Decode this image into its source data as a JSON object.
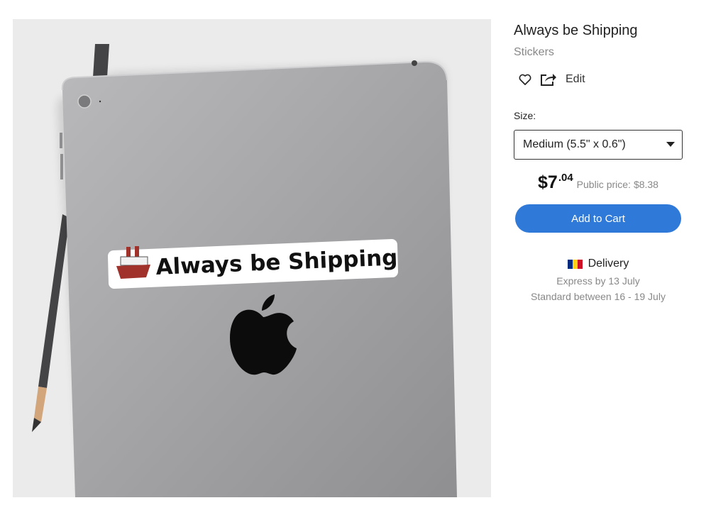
{
  "product": {
    "title": "Always be Shipping",
    "category": "Stickers",
    "sticker_text": "Always be Shipping",
    "sticker_emoji_icon": "ship-icon"
  },
  "actions": {
    "favorite_icon": "heart-icon",
    "share_icon": "share-icon",
    "edit_label": "Edit"
  },
  "size": {
    "label": "Size:",
    "selected": "Medium (5.5\" x 0.6\")"
  },
  "price": {
    "currency": "$",
    "dollars": "7",
    "cents": ".04",
    "public_label": "Public price:",
    "public_value": "$8.38"
  },
  "cart": {
    "button_label": "Add to Cart",
    "button_color": "#2f79d8"
  },
  "delivery": {
    "title": "Delivery",
    "flag_colors": [
      "#002b7f",
      "#fcd116",
      "#ce1126"
    ],
    "express": "Express by 13 July",
    "standard": "Standard between 16 - 19 July"
  }
}
